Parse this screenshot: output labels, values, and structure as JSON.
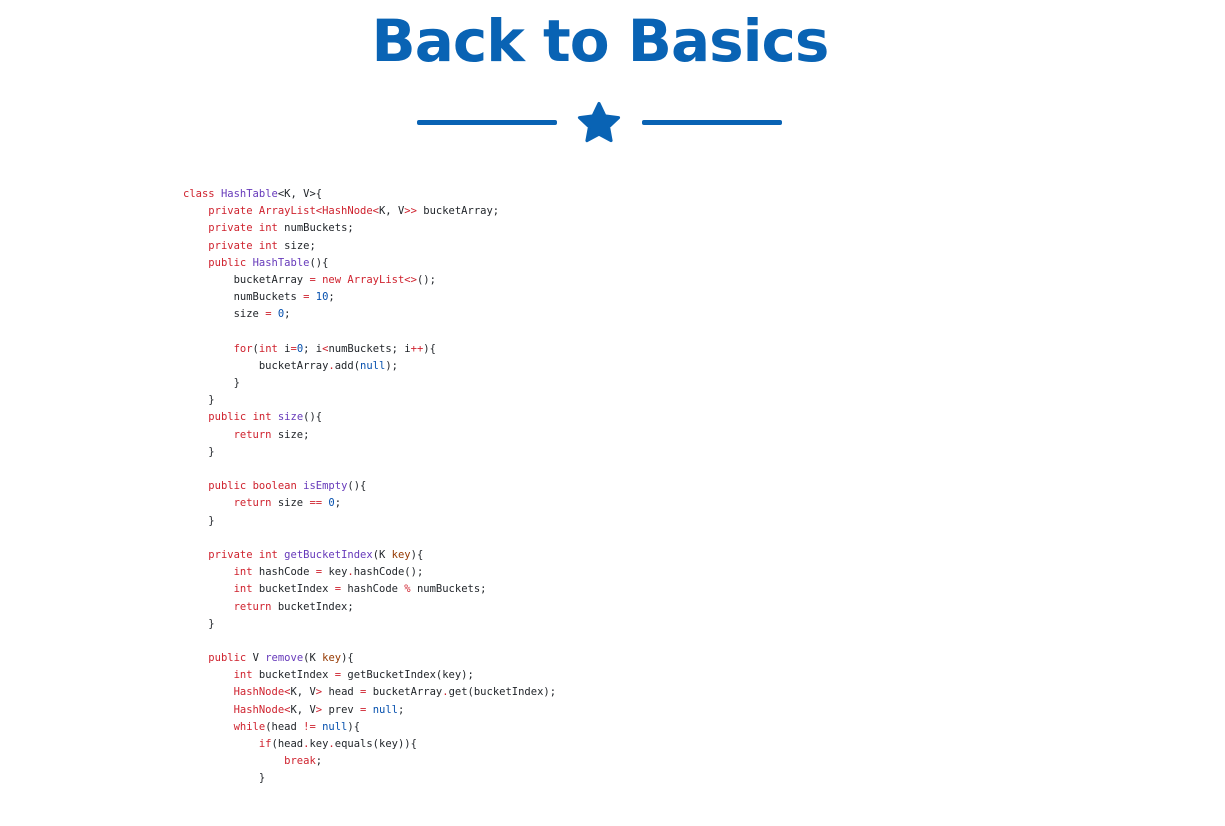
{
  "header": {
    "title": "Back to Basics",
    "divider_icon": "star-icon"
  },
  "colors": {
    "brand": "#0963b4",
    "keyword": "#cf222e",
    "function": "#6639ba",
    "number": "#0550ae",
    "parameter": "#953800",
    "text": "#1f2328"
  },
  "code": {
    "language": "java",
    "lines": [
      [
        [
          "class ",
          "kw"
        ],
        [
          "HashTable",
          "fn"
        ],
        [
          "<K, V>{",
          ""
        ]
      ],
      [
        [
          "    ",
          ""
        ],
        [
          "private ",
          "kw"
        ],
        [
          "ArrayList<HashNode<",
          "kw"
        ],
        [
          "K, V",
          ""
        ],
        [
          ">> ",
          "kw"
        ],
        [
          "bucketArray;",
          ""
        ]
      ],
      [
        [
          "    ",
          ""
        ],
        [
          "private ",
          "kw"
        ],
        [
          "int ",
          "kw"
        ],
        [
          "numBuckets;",
          ""
        ]
      ],
      [
        [
          "    ",
          ""
        ],
        [
          "private ",
          "kw"
        ],
        [
          "int ",
          "kw"
        ],
        [
          "size;",
          ""
        ]
      ],
      [
        [
          "    ",
          ""
        ],
        [
          "public ",
          "kw"
        ],
        [
          "HashTable",
          "fn"
        ],
        [
          "(){",
          ""
        ]
      ],
      [
        [
          "        bucketArray ",
          ""
        ],
        [
          "= ",
          "op"
        ],
        [
          "new ",
          "kw"
        ],
        [
          "ArrayList<>",
          "kw"
        ],
        [
          "();",
          ""
        ]
      ],
      [
        [
          "        numBuckets ",
          ""
        ],
        [
          "= ",
          "op"
        ],
        [
          "10",
          "num"
        ],
        [
          ";",
          ""
        ]
      ],
      [
        [
          "        size ",
          ""
        ],
        [
          "= ",
          "op"
        ],
        [
          "0",
          "num"
        ],
        [
          ";",
          ""
        ]
      ],
      [
        [
          "",
          ""
        ]
      ],
      [
        [
          "        ",
          ""
        ],
        [
          "for",
          "kw"
        ],
        [
          "(",
          ""
        ],
        [
          "int ",
          "kw"
        ],
        [
          "i",
          ""
        ],
        [
          "=",
          "op"
        ],
        [
          "0",
          "num"
        ],
        [
          "; i",
          ""
        ],
        [
          "<",
          "op"
        ],
        [
          "numBuckets; i",
          ""
        ],
        [
          "++",
          "op"
        ],
        [
          "){",
          ""
        ]
      ],
      [
        [
          "            bucketArray",
          ""
        ],
        [
          ".",
          "op"
        ],
        [
          "add(",
          ""
        ],
        [
          "null",
          "num"
        ],
        [
          ");",
          ""
        ]
      ],
      [
        [
          "        }",
          ""
        ]
      ],
      [
        [
          "    }",
          ""
        ]
      ],
      [
        [
          "    ",
          ""
        ],
        [
          "public ",
          "kw"
        ],
        [
          "int ",
          "kw"
        ],
        [
          "size",
          "fn"
        ],
        [
          "(){",
          ""
        ]
      ],
      [
        [
          "        ",
          ""
        ],
        [
          "return ",
          "kw"
        ],
        [
          "size;",
          ""
        ]
      ],
      [
        [
          "    }",
          ""
        ]
      ],
      [
        [
          "",
          ""
        ]
      ],
      [
        [
          "    ",
          ""
        ],
        [
          "public ",
          "kw"
        ],
        [
          "boolean ",
          "kw"
        ],
        [
          "isEmpty",
          "fn"
        ],
        [
          "(){",
          ""
        ]
      ],
      [
        [
          "        ",
          ""
        ],
        [
          "return ",
          "kw"
        ],
        [
          "size ",
          ""
        ],
        [
          "== ",
          "op"
        ],
        [
          "0",
          "num"
        ],
        [
          ";",
          ""
        ]
      ],
      [
        [
          "    }",
          ""
        ]
      ],
      [
        [
          "",
          ""
        ]
      ],
      [
        [
          "    ",
          ""
        ],
        [
          "private ",
          "kw"
        ],
        [
          "int ",
          "kw"
        ],
        [
          "getBucketIndex",
          "fn"
        ],
        [
          "(K ",
          ""
        ],
        [
          "key",
          "par"
        ],
        [
          "){",
          ""
        ]
      ],
      [
        [
          "        ",
          ""
        ],
        [
          "int ",
          "kw"
        ],
        [
          "hashCode ",
          ""
        ],
        [
          "= ",
          "op"
        ],
        [
          "key",
          ""
        ],
        [
          ".",
          "op"
        ],
        [
          "hashCode();",
          ""
        ]
      ],
      [
        [
          "        ",
          ""
        ],
        [
          "int ",
          "kw"
        ],
        [
          "bucketIndex ",
          ""
        ],
        [
          "= ",
          "op"
        ],
        [
          "hashCode ",
          ""
        ],
        [
          "% ",
          "op"
        ],
        [
          "numBuckets;",
          ""
        ]
      ],
      [
        [
          "        ",
          ""
        ],
        [
          "return ",
          "kw"
        ],
        [
          "bucketIndex;",
          ""
        ]
      ],
      [
        [
          "    }",
          ""
        ]
      ],
      [
        [
          "",
          ""
        ]
      ],
      [
        [
          "    ",
          ""
        ],
        [
          "public ",
          "kw"
        ],
        [
          "V ",
          ""
        ],
        [
          "remove",
          "fn"
        ],
        [
          "(K ",
          ""
        ],
        [
          "key",
          "par"
        ],
        [
          "){",
          ""
        ]
      ],
      [
        [
          "        ",
          ""
        ],
        [
          "int ",
          "kw"
        ],
        [
          "bucketIndex ",
          ""
        ],
        [
          "= ",
          "op"
        ],
        [
          "getBucketIndex(key);",
          ""
        ]
      ],
      [
        [
          "        ",
          ""
        ],
        [
          "HashNode<",
          "kw"
        ],
        [
          "K, V",
          ""
        ],
        [
          "> ",
          "kw"
        ],
        [
          "head ",
          ""
        ],
        [
          "= ",
          "op"
        ],
        [
          "bucketArray",
          ""
        ],
        [
          ".",
          "op"
        ],
        [
          "get(bucketIndex);",
          ""
        ]
      ],
      [
        [
          "        ",
          ""
        ],
        [
          "HashNode<",
          "kw"
        ],
        [
          "K, V",
          ""
        ],
        [
          "> ",
          "kw"
        ],
        [
          "prev ",
          ""
        ],
        [
          "= ",
          "op"
        ],
        [
          "null",
          "num"
        ],
        [
          ";",
          ""
        ]
      ],
      [
        [
          "        ",
          ""
        ],
        [
          "while",
          "kw"
        ],
        [
          "(head ",
          ""
        ],
        [
          "!= ",
          "op"
        ],
        [
          "null",
          "num"
        ],
        [
          "){",
          ""
        ]
      ],
      [
        [
          "            ",
          ""
        ],
        [
          "if",
          "kw"
        ],
        [
          "(head",
          ""
        ],
        [
          ".",
          "op"
        ],
        [
          "key",
          ""
        ],
        [
          ".",
          "op"
        ],
        [
          "equals(key)){",
          ""
        ]
      ],
      [
        [
          "                ",
          ""
        ],
        [
          "break",
          "kw"
        ],
        [
          ";",
          ""
        ]
      ],
      [
        [
          "            }",
          ""
        ]
      ]
    ]
  }
}
